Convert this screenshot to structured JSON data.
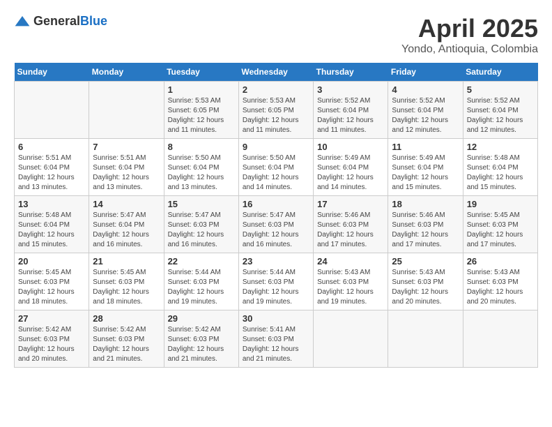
{
  "header": {
    "logo_general": "General",
    "logo_blue": "Blue",
    "month_title": "April 2025",
    "location": "Yondo, Antioquia, Colombia"
  },
  "days_of_week": [
    "Sunday",
    "Monday",
    "Tuesday",
    "Wednesday",
    "Thursday",
    "Friday",
    "Saturday"
  ],
  "weeks": [
    [
      null,
      null,
      {
        "day": 1,
        "sunrise": "5:53 AM",
        "sunset": "6:05 PM",
        "daylight": "12 hours and 11 minutes."
      },
      {
        "day": 2,
        "sunrise": "5:53 AM",
        "sunset": "6:05 PM",
        "daylight": "12 hours and 11 minutes."
      },
      {
        "day": 3,
        "sunrise": "5:52 AM",
        "sunset": "6:04 PM",
        "daylight": "12 hours and 11 minutes."
      },
      {
        "day": 4,
        "sunrise": "5:52 AM",
        "sunset": "6:04 PM",
        "daylight": "12 hours and 12 minutes."
      },
      {
        "day": 5,
        "sunrise": "5:52 AM",
        "sunset": "6:04 PM",
        "daylight": "12 hours and 12 minutes."
      }
    ],
    [
      {
        "day": 6,
        "sunrise": "5:51 AM",
        "sunset": "6:04 PM",
        "daylight": "12 hours and 13 minutes."
      },
      {
        "day": 7,
        "sunrise": "5:51 AM",
        "sunset": "6:04 PM",
        "daylight": "12 hours and 13 minutes."
      },
      {
        "day": 8,
        "sunrise": "5:50 AM",
        "sunset": "6:04 PM",
        "daylight": "12 hours and 13 minutes."
      },
      {
        "day": 9,
        "sunrise": "5:50 AM",
        "sunset": "6:04 PM",
        "daylight": "12 hours and 14 minutes."
      },
      {
        "day": 10,
        "sunrise": "5:49 AM",
        "sunset": "6:04 PM",
        "daylight": "12 hours and 14 minutes."
      },
      {
        "day": 11,
        "sunrise": "5:49 AM",
        "sunset": "6:04 PM",
        "daylight": "12 hours and 15 minutes."
      },
      {
        "day": 12,
        "sunrise": "5:48 AM",
        "sunset": "6:04 PM",
        "daylight": "12 hours and 15 minutes."
      }
    ],
    [
      {
        "day": 13,
        "sunrise": "5:48 AM",
        "sunset": "6:04 PM",
        "daylight": "12 hours and 15 minutes."
      },
      {
        "day": 14,
        "sunrise": "5:47 AM",
        "sunset": "6:04 PM",
        "daylight": "12 hours and 16 minutes."
      },
      {
        "day": 15,
        "sunrise": "5:47 AM",
        "sunset": "6:03 PM",
        "daylight": "12 hours and 16 minutes."
      },
      {
        "day": 16,
        "sunrise": "5:47 AM",
        "sunset": "6:03 PM",
        "daylight": "12 hours and 16 minutes."
      },
      {
        "day": 17,
        "sunrise": "5:46 AM",
        "sunset": "6:03 PM",
        "daylight": "12 hours and 17 minutes."
      },
      {
        "day": 18,
        "sunrise": "5:46 AM",
        "sunset": "6:03 PM",
        "daylight": "12 hours and 17 minutes."
      },
      {
        "day": 19,
        "sunrise": "5:45 AM",
        "sunset": "6:03 PM",
        "daylight": "12 hours and 17 minutes."
      }
    ],
    [
      {
        "day": 20,
        "sunrise": "5:45 AM",
        "sunset": "6:03 PM",
        "daylight": "12 hours and 18 minutes."
      },
      {
        "day": 21,
        "sunrise": "5:45 AM",
        "sunset": "6:03 PM",
        "daylight": "12 hours and 18 minutes."
      },
      {
        "day": 22,
        "sunrise": "5:44 AM",
        "sunset": "6:03 PM",
        "daylight": "12 hours and 19 minutes."
      },
      {
        "day": 23,
        "sunrise": "5:44 AM",
        "sunset": "6:03 PM",
        "daylight": "12 hours and 19 minutes."
      },
      {
        "day": 24,
        "sunrise": "5:43 AM",
        "sunset": "6:03 PM",
        "daylight": "12 hours and 19 minutes."
      },
      {
        "day": 25,
        "sunrise": "5:43 AM",
        "sunset": "6:03 PM",
        "daylight": "12 hours and 20 minutes."
      },
      {
        "day": 26,
        "sunrise": "5:43 AM",
        "sunset": "6:03 PM",
        "daylight": "12 hours and 20 minutes."
      }
    ],
    [
      {
        "day": 27,
        "sunrise": "5:42 AM",
        "sunset": "6:03 PM",
        "daylight": "12 hours and 20 minutes."
      },
      {
        "day": 28,
        "sunrise": "5:42 AM",
        "sunset": "6:03 PM",
        "daylight": "12 hours and 21 minutes."
      },
      {
        "day": 29,
        "sunrise": "5:42 AM",
        "sunset": "6:03 PM",
        "daylight": "12 hours and 21 minutes."
      },
      {
        "day": 30,
        "sunrise": "5:41 AM",
        "sunset": "6:03 PM",
        "daylight": "12 hours and 21 minutes."
      },
      null,
      null,
      null
    ]
  ]
}
